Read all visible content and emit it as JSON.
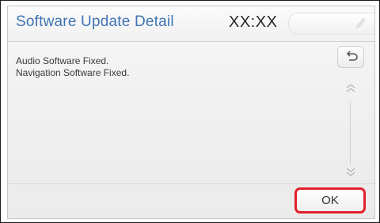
{
  "header": {
    "title": "Software Update Detail",
    "clock": "XX:XX",
    "status_icon": "signal-icon"
  },
  "content": {
    "lines": [
      "Audio Software Fixed.",
      "Navigation Software Fixed."
    ]
  },
  "controls": {
    "back_icon": "back-arrow-icon",
    "scroll_up_icon": "double-chevron-up-icon",
    "scroll_down_icon": "double-chevron-down-icon",
    "ok_label": "OK"
  },
  "colors": {
    "title": "#3f74b4",
    "highlight": "#e0202a"
  }
}
